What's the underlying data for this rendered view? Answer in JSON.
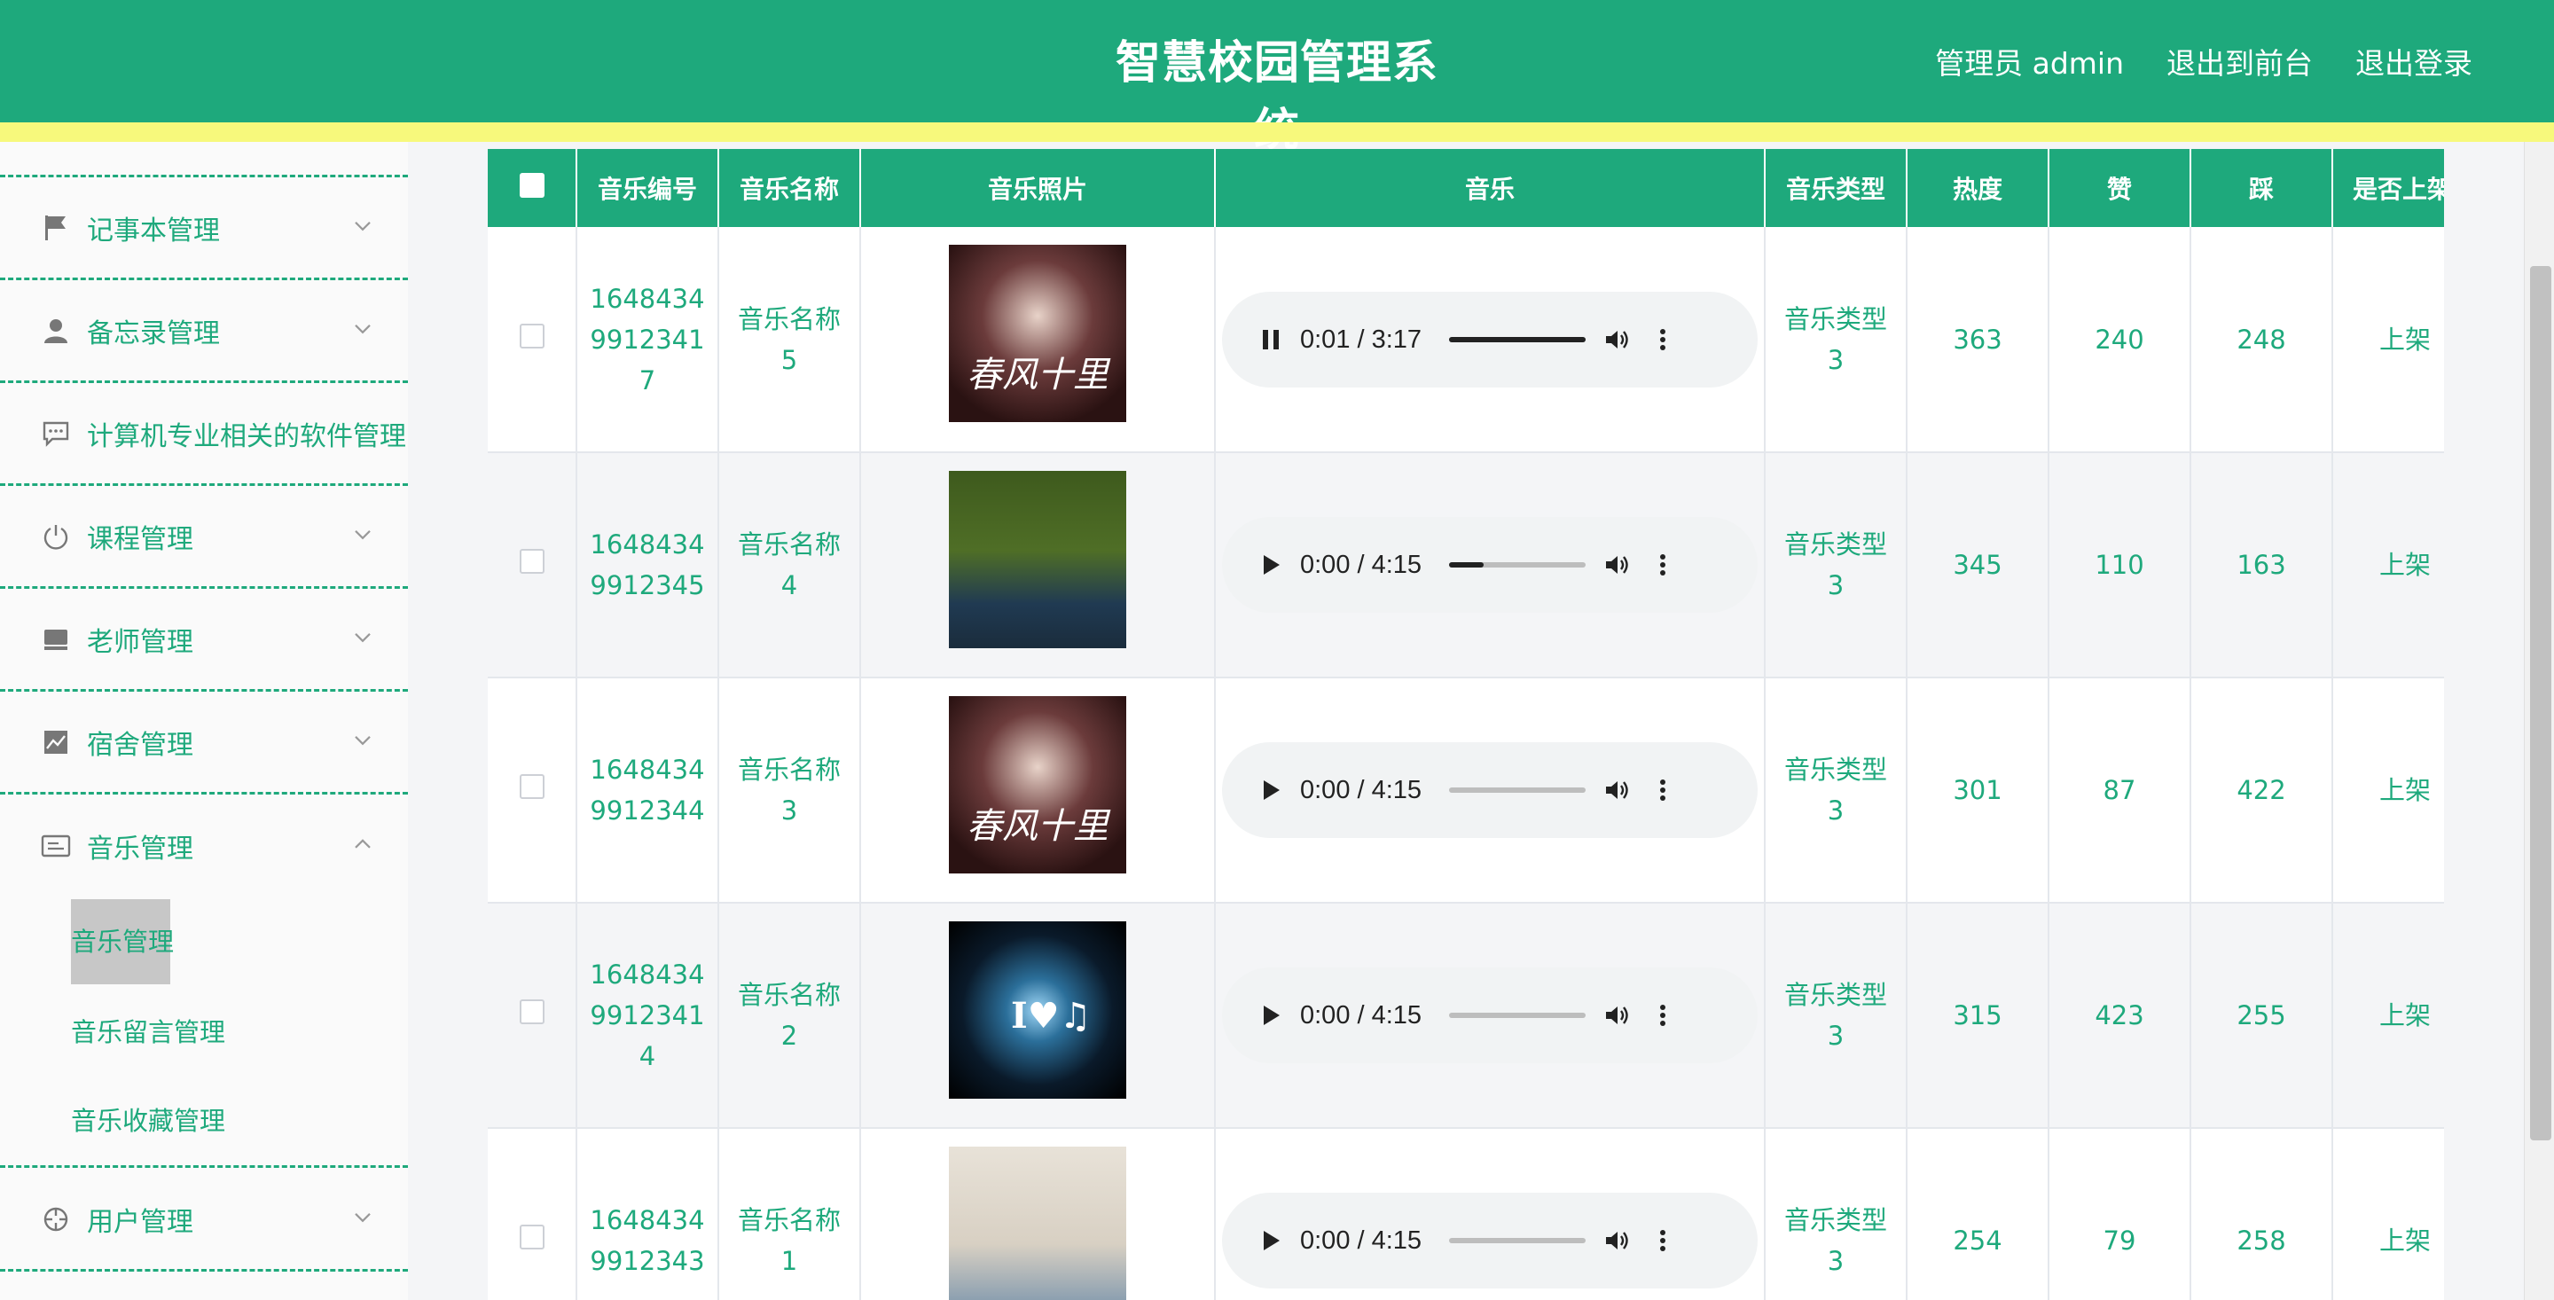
{
  "header": {
    "title": "智慧校园管理系统",
    "admin_label": "管理员 admin",
    "back_front_label": "退出到前台",
    "logout_label": "退出登录"
  },
  "sidebar": {
    "items": [
      {
        "label": "记事本管理",
        "icon": "flag-icon"
      },
      {
        "label": "备忘录管理",
        "icon": "user-icon"
      },
      {
        "label": "计算机专业相关的软件管理",
        "icon": "chat-icon"
      },
      {
        "label": "课程管理",
        "icon": "power-icon"
      },
      {
        "label": "老师管理",
        "icon": "monitor-icon"
      },
      {
        "label": "宿舍管理",
        "icon": "chart-icon"
      },
      {
        "label": "音乐管理",
        "icon": "card-icon"
      },
      {
        "label": "用户管理",
        "icon": "crosshair-icon"
      }
    ],
    "submenu": [
      "音乐管理",
      "音乐留言管理",
      "音乐收藏管理"
    ]
  },
  "table": {
    "headers": [
      "音乐编号",
      "音乐名称",
      "音乐照片",
      "音乐",
      "音乐类型",
      "热度",
      "赞",
      "踩",
      "是否上架"
    ],
    "rows": [
      {
        "id_l1": "1648434",
        "id_l2": "9912341",
        "id_l3": "7",
        "name_l1": "音乐名称",
        "name_l2": "5",
        "cover_text": "春风十里",
        "time": "0:01 / 3:17",
        "progress": 1.0,
        "playing": true,
        "type_l1": "音乐类型",
        "type_l2": "3",
        "heat": "363",
        "likes": "240",
        "dislikes": "248",
        "status": "上架"
      },
      {
        "id_l1": "1648434",
        "id_l2": "9912345",
        "id_l3": "",
        "name_l1": "音乐名称",
        "name_l2": "4",
        "cover_text": "",
        "time": "0:00 / 4:15",
        "progress": 0.25,
        "playing": false,
        "type_l1": "音乐类型",
        "type_l2": "3",
        "heat": "345",
        "likes": "110",
        "dislikes": "163",
        "status": "上架"
      },
      {
        "id_l1": "1648434",
        "id_l2": "9912344",
        "id_l3": "",
        "name_l1": "音乐名称",
        "name_l2": "3",
        "cover_text": "春风十里",
        "time": "0:00 / 4:15",
        "progress": 0,
        "playing": false,
        "type_l1": "音乐类型",
        "type_l2": "3",
        "heat": "301",
        "likes": "87",
        "dislikes": "422",
        "status": "上架"
      },
      {
        "id_l1": "1648434",
        "id_l2": "9912341",
        "id_l3": "4",
        "name_l1": "音乐名称",
        "name_l2": "2",
        "cover_text": "I♥♫",
        "time": "0:00 / 4:15",
        "progress": 0,
        "playing": false,
        "type_l1": "音乐类型",
        "type_l2": "3",
        "heat": "315",
        "likes": "423",
        "dislikes": "255",
        "status": "上架"
      },
      {
        "id_l1": "1648434",
        "id_l2": "9912343",
        "id_l3": "",
        "name_l1": "音乐名称",
        "name_l2": "1",
        "cover_text": "",
        "time": "0:00 / 4:15",
        "progress": 0,
        "playing": false,
        "type_l1": "音乐类型",
        "type_l2": "3",
        "heat": "254",
        "likes": "79",
        "dislikes": "258",
        "status": "上架"
      }
    ]
  },
  "colors": {
    "accent": "#1ea97c",
    "stripe": "#f7f97c"
  }
}
